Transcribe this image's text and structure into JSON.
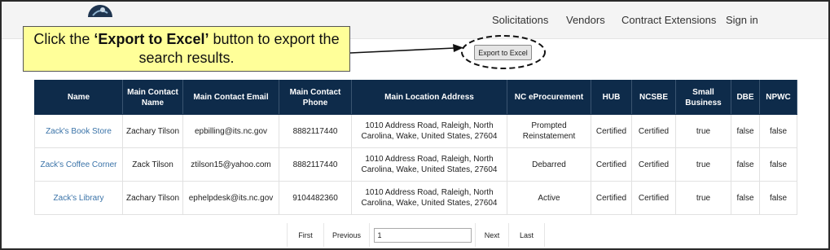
{
  "nav": {
    "links": [
      "Solicitations",
      "Vendors",
      "Contract Extensions",
      "Sign in"
    ]
  },
  "callout": {
    "before": "Click the ",
    "highlight": "‘Export to Excel’",
    "after": " button to export the search results."
  },
  "export_button": {
    "label": "Export to Excel"
  },
  "table": {
    "headers": [
      "Name",
      "Main Contact Name",
      "Main Contact Email",
      "Main Contact Phone",
      "Main Location Address",
      "NC eProcurement",
      "HUB",
      "NCSBE",
      "Small Business",
      "DBE",
      "NPWC"
    ],
    "rows": [
      [
        "Zack's Book Store",
        "Zachary Tilson",
        "epbilling@its.nc.gov",
        "8882117440",
        "1010 Address Road, Raleigh, North Carolina, Wake, United States, 27604",
        "Prompted Reinstatement",
        "Certified",
        "Certified",
        "true",
        "false",
        "false"
      ],
      [
        "Zack's Coffee Corner",
        "Zack Tilson",
        "ztilson15@yahoo.com",
        "8882117440",
        "1010 Address Road, Raleigh, North Carolina, Wake, United States, 27604",
        "Debarred",
        "Certified",
        "Certified",
        "true",
        "false",
        "false"
      ],
      [
        "Zack's Library",
        "Zachary Tilson",
        "ephelpdesk@its.nc.gov",
        "9104482360",
        "1010 Address Road, Raleigh, North Carolina, Wake, United States, 27604",
        "Active",
        "Certified",
        "Certified",
        "true",
        "false",
        "false"
      ]
    ]
  },
  "pagination": {
    "first": "First",
    "previous": "Previous",
    "page_value": "1",
    "next": "Next",
    "last": "Last"
  },
  "colors": {
    "header_bg": "#0e2b4a",
    "link": "#3a73a8",
    "callout_bg": "#ffff99",
    "navbar_bg": "#f4f4f4"
  }
}
